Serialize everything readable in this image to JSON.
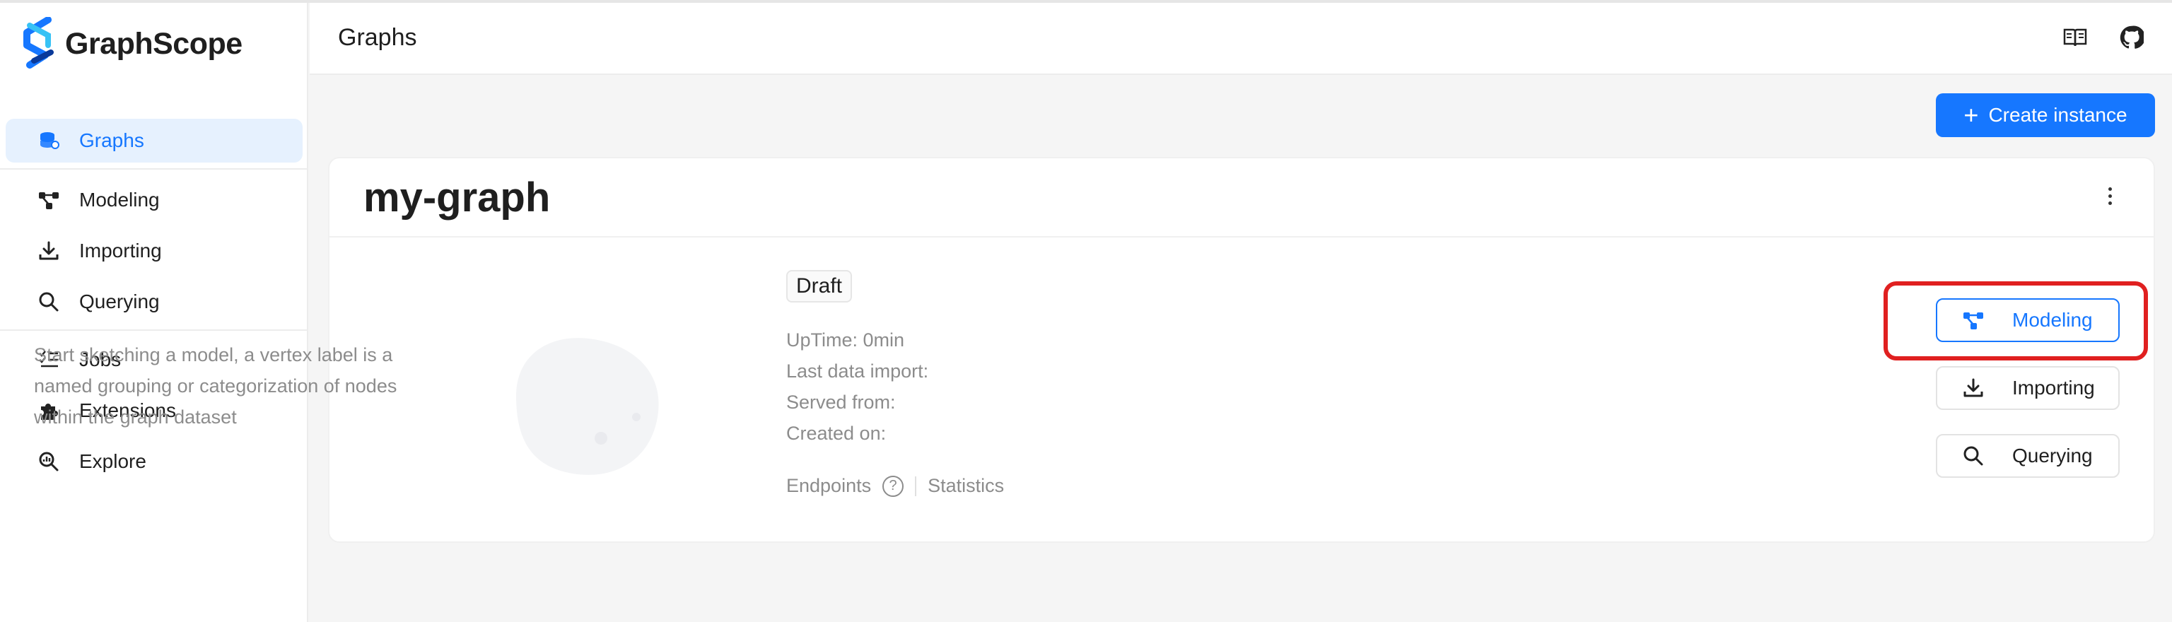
{
  "brand": {
    "name": "GraphScope",
    "accent": "#1677ff"
  },
  "sidebar": {
    "items": [
      {
        "label": "Graphs",
        "icon": "database-icon"
      },
      {
        "label": "Modeling",
        "icon": "nodes-icon"
      },
      {
        "label": "Importing",
        "icon": "download-icon"
      },
      {
        "label": "Querying",
        "icon": "search-icon"
      },
      {
        "label": "Jobs",
        "icon": "list-check-icon"
      },
      {
        "label": "Extensions",
        "icon": "puzzle-icon"
      },
      {
        "label": "Explore",
        "icon": "explore-icon"
      }
    ]
  },
  "header": {
    "title": "Graphs",
    "icons": [
      "book-icon",
      "github-icon"
    ]
  },
  "toolbar": {
    "create_label": "Create instance"
  },
  "card": {
    "title": "my-graph",
    "status": "Draft",
    "description": "Start sketching a model, a vertex label is a named grouping or categorization of nodes within the graph dataset",
    "meta": {
      "uptime": "UpTime: 0min",
      "last_import": "Last data import:",
      "served_from": "Served from:",
      "created_on": "Created on:"
    },
    "links": {
      "endpoints": "Endpoints",
      "help": "?",
      "statistics": "Statistics"
    },
    "actions": {
      "modeling": "Modeling",
      "importing": "Importing",
      "querying": "Querying"
    }
  }
}
